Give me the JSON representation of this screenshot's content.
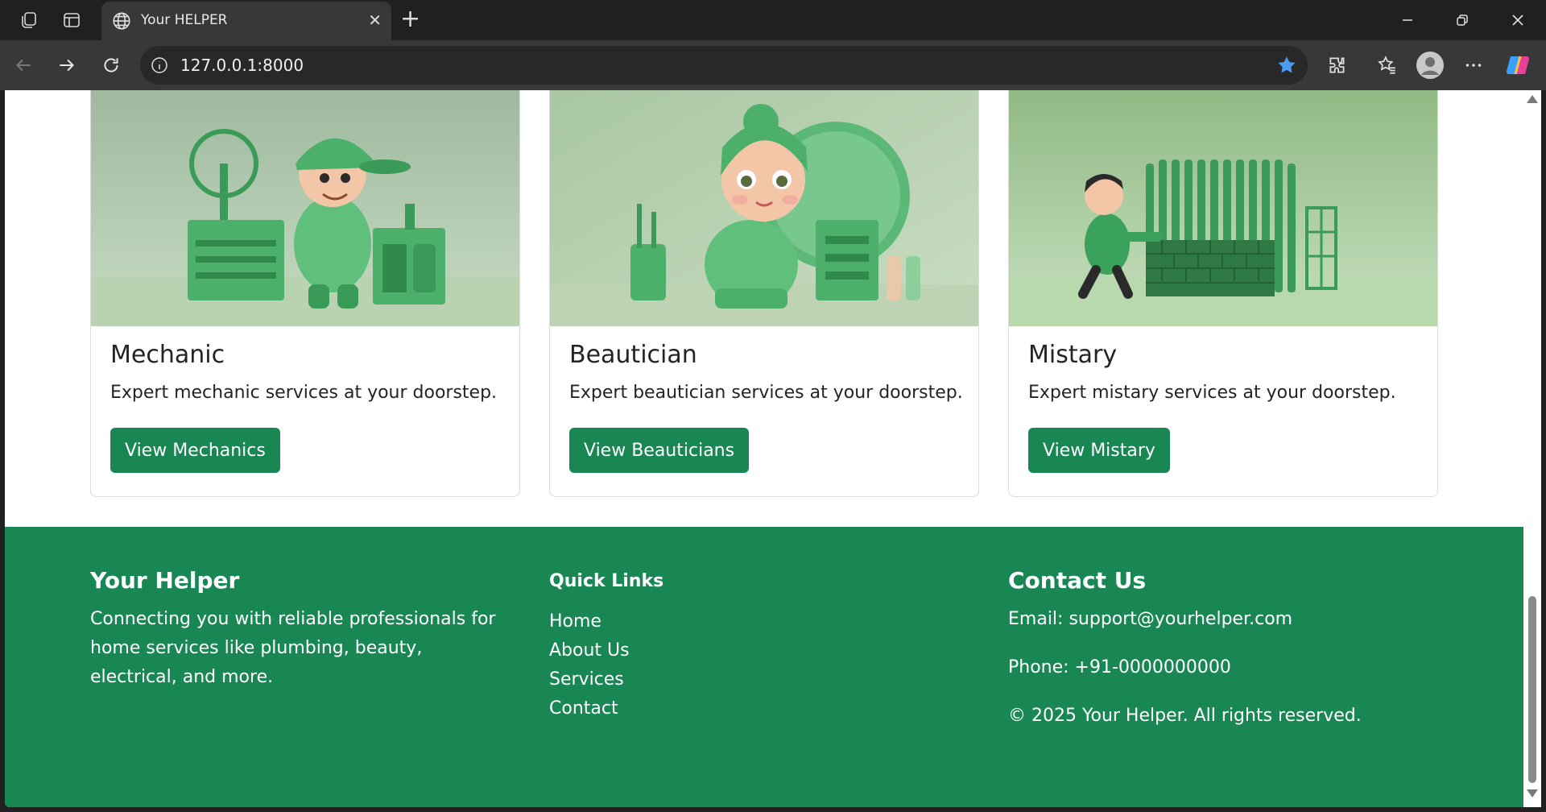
{
  "browser": {
    "tab_title": "Your HELPER",
    "url": "127.0.0.1:8000"
  },
  "cards": [
    {
      "title": "Mechanic",
      "text": "Expert mechanic services at your doorstep.",
      "button": "View Mechanics"
    },
    {
      "title": "Beautician",
      "text": "Expert beautician services at your doorstep.",
      "button": "View Beauticians"
    },
    {
      "title": "Mistary",
      "text": "Expert mistary services at your doorstep.",
      "button": "View Mistary"
    }
  ],
  "footer": {
    "about": {
      "heading": "Your Helper",
      "text": "Connecting you with reliable professionals for home services like plumbing, beauty, electrical, and more."
    },
    "links": {
      "heading": "Quick Links",
      "items": [
        "Home",
        "About Us",
        "Services",
        "Contact"
      ]
    },
    "contact": {
      "heading": "Contact Us",
      "email": "Email: support@yourhelper.com",
      "phone": "Phone: +91-0000000000",
      "copyright": "© 2025 Your Helper. All rights reserved."
    }
  },
  "colors": {
    "primary_green": "#198754",
    "chrome_dark": "#202020",
    "chrome_toolbar": "#383838"
  },
  "icons": [
    "workspaces-icon",
    "tab-actions-icon",
    "globe-icon",
    "close-icon",
    "new-tab-icon",
    "minimize-icon",
    "restore-icon",
    "window-close-icon",
    "back-icon",
    "forward-icon",
    "refresh-icon",
    "info-icon",
    "star-icon",
    "extensions-icon",
    "favorites-icon",
    "profile-icon",
    "more-icon",
    "copilot-icon"
  ]
}
